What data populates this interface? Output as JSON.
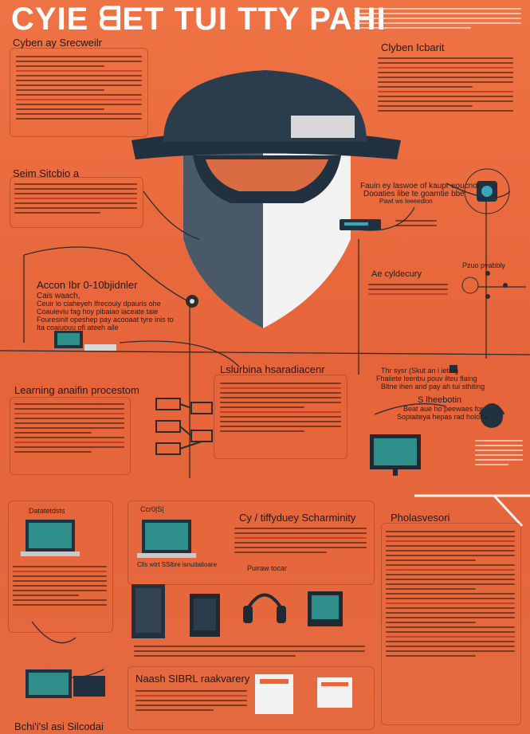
{
  "header": {
    "title": "CYIE ᗺET TUI TTY PAHI"
  },
  "top_left": {
    "heading": "Cyben ay Srecweilr"
  },
  "top_right": {
    "heading": "Clyben Icbarit"
  },
  "left_mid": {
    "heading": "Seim Sitcbio a"
  },
  "right_mid": {
    "text1": "Fauin ey laswoe of kaupr eoucnol",
    "text2": "Dooaties libe te goamtie bbe",
    "text3": "Pawt ws leeeedlon",
    "small_label": "Pzuo pvabbly",
    "cyber_label": "Ae cyldecury"
  },
  "left_desc": {
    "heading": "Accon Ibr 0-10bjidnler",
    "line1": "Cais waach,",
    "line2": "Ceuir lo ciaheyeh Ifrecouiy dpauris ohe",
    "line3": "Coauieviu fag hoy pibaiao iaceate taie",
    "line4": "Fouresinit opeshep pay acooaat tyre inis to",
    "line5": "Ita coaiuouu ofi ateeh aile"
  },
  "learning": {
    "heading": "Learning anaifin procestom"
  },
  "center": {
    "heading": "Lslurbina hsaradiacenr"
  },
  "right_lower": {
    "text1": "Thr sysr (Skut an i ieting",
    "text2": "Fhaiiete leenbu pouv ilteu flaing",
    "text3": "Bltne ihen and pay ah tui sthiting",
    "sub_heading": "S lheebotin",
    "text4": "Beat aue ho peewaes for",
    "text5": "Sopiaiteya hepas rad holoha"
  },
  "bottom": {
    "panel1_label": "Datatetdsts",
    "panel2_label": "Ccr0|S|",
    "center_heading": "Cy / tiffyduey Scharminity",
    "center_label": "Puiraw tocar",
    "bottom_caption": "Clls wtrt SSibre isnuitaitoare",
    "right_heading": "Pholasvesori",
    "recovery_heading": "Naash SIBRL raakvarery",
    "footer": "Bchi'i'sl asi Silcodai"
  },
  "colors": {
    "background": "#e8663a",
    "hat": "#2b3d4d",
    "face_light": "#f2f2f2",
    "face_shadow": "#3b4a58",
    "wire": "#2c2c2c",
    "panel_border": "#8a3a20"
  }
}
